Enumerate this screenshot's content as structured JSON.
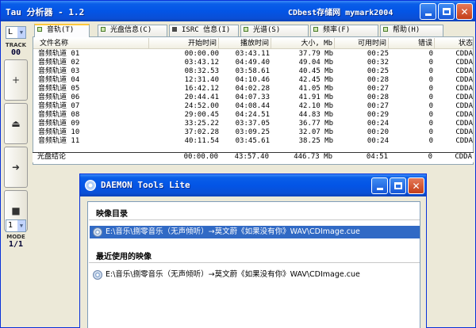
{
  "window": {
    "title": "Tau 分析器 - 1.2",
    "right_title": "CDbest存储网 mymark2004",
    "minimize_label": "",
    "maximize_label": "",
    "close_label": "✕"
  },
  "left_panel": {
    "drive_letter": "L",
    "track_label": "TRACK",
    "track_number": "00",
    "buttons": [
      "+",
      "⏏",
      "➜",
      "■"
    ],
    "mode_select": "1",
    "mode_label": "MODE",
    "mode_value": "1/1"
  },
  "tabs": [
    {
      "label": "音轨(T)",
      "active": true
    },
    {
      "label": "光盘信息(C)",
      "active": false
    },
    {
      "label": "ISRC 信息(I)",
      "active": false
    },
    {
      "label": "光谱(S)",
      "active": false
    },
    {
      "label": "频率(F)",
      "active": false
    },
    {
      "label": "帮助(H)",
      "active": false
    }
  ],
  "table": {
    "columns": [
      "文件名称",
      "开始时间",
      "播放时间",
      "大小, Mb",
      "可用时间",
      "错误",
      "状态"
    ],
    "rows": [
      [
        "音频轨道 01",
        "00:00.00",
        "03:43.11",
        "37.79 Mb",
        "00:25",
        "0",
        "CDDA"
      ],
      [
        "音频轨道 02",
        "03:43.12",
        "04:49.40",
        "49.04 Mb",
        "00:32",
        "0",
        "CDDA"
      ],
      [
        "音频轨道 03",
        "08:32.53",
        "03:58.61",
        "40.45 Mb",
        "00:25",
        "0",
        "CDDA"
      ],
      [
        "音频轨道 04",
        "12:31.40",
        "04:10.46",
        "42.45 Mb",
        "00:28",
        "0",
        "CDDA"
      ],
      [
        "音频轨道 05",
        "16:42.12",
        "04:02.28",
        "41.05 Mb",
        "00:27",
        "0",
        "CDDA"
      ],
      [
        "音频轨道 06",
        "20:44.41",
        "04:07.33",
        "41.91 Mb",
        "00:28",
        "0",
        "CDDA"
      ],
      [
        "音频轨道 07",
        "24:52.00",
        "04:08.44",
        "42.10 Mb",
        "00:27",
        "0",
        "CDDA"
      ],
      [
        "音频轨道 08",
        "29:00.45",
        "04:24.51",
        "44.83 Mb",
        "00:29",
        "0",
        "CDDA"
      ],
      [
        "音频轨道 09",
        "33:25.22",
        "03:37.05",
        "36.77 Mb",
        "00:24",
        "0",
        "CDDA"
      ],
      [
        "音频轨道 10",
        "37:02.28",
        "03:09.25",
        "32.07 Mb",
        "00:20",
        "0",
        "CDDA"
      ],
      [
        "音频轨道 11",
        "40:11.54",
        "03:45.61",
        "38.25 Mb",
        "00:24",
        "0",
        "CDDA"
      ]
    ],
    "total": [
      "光盘结论",
      "00:00.00",
      "43:57.40",
      "446.73 Mb",
      "04:51",
      "0",
      "CDDA"
    ]
  },
  "dialog": {
    "title": "DAEMON Tools Lite",
    "section_images": "映像目录",
    "section_recent": "最近使用的映像",
    "image_path": "E:\\音乐\\捌零音乐（无声倾听）→莫文蔚《如果没有你》WAV\\CDImage.cue",
    "recent_path": "E:\\音乐\\捌零音乐（无声倾听）→莫文蔚《如果没有你》WAV\\CDImage.cue"
  },
  "colors": {
    "titlebar_blue": "#0355e6",
    "selection_blue": "#316ac5",
    "tab_active_accent": "#ffc83c"
  }
}
